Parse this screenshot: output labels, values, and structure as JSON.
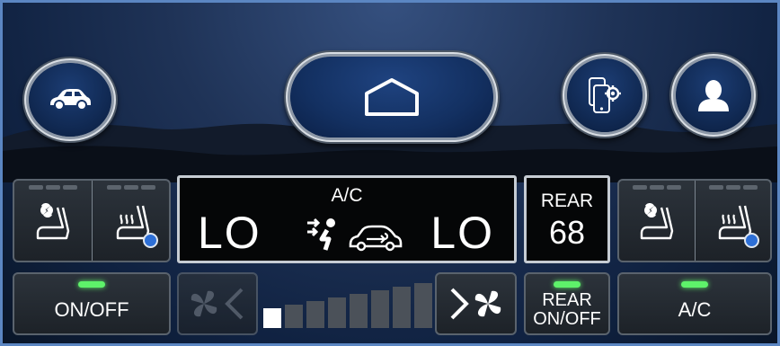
{
  "top_bar": {
    "car_icon": "car-icon",
    "home_icon": "home-icon",
    "phone_settings_icon": "phone-settings-icon",
    "profile_icon": "profile-icon"
  },
  "climate": {
    "ac_status": "A/C",
    "left_temp": "LO",
    "right_temp": "LO",
    "airflow_icon": "airflow-face-icon",
    "recirc_icon": "recirculation-icon",
    "rear_label": "REAR",
    "rear_temp": "68"
  },
  "buttons": {
    "on_off": "ON/OFF",
    "rear_on_off_line1": "REAR",
    "rear_on_off_line2": "ON/OFF",
    "ac": "A/C"
  },
  "fan": {
    "level": 1,
    "max_level": 8
  },
  "colors": {
    "accent_green": "#5ef26a",
    "indicator_blue": "#2d6fd6",
    "border_blue": "#5b86c2"
  }
}
